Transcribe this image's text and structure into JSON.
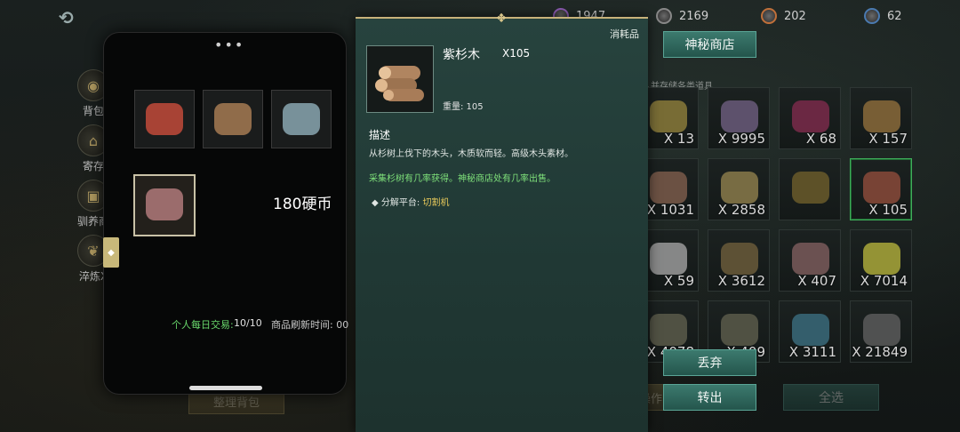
{
  "currencies": [
    {
      "icon": "purple-gem-icon",
      "value": "1947"
    },
    {
      "icon": "silver-coin-icon",
      "value": "2169"
    },
    {
      "icon": "orange-coin-icon",
      "value": "202"
    },
    {
      "icon": "blue-orb-icon",
      "value": "62"
    }
  ],
  "side_menu": [
    {
      "label": "背包",
      "icon": "bag-icon"
    },
    {
      "label": "寄存",
      "icon": "house-icon"
    },
    {
      "label": "驯养商",
      "icon": "chest-icon"
    },
    {
      "label": "淬炼X",
      "icon": "feather-icon"
    }
  ],
  "shop": {
    "mystery_shop_label": "神秘商店",
    "hint": "入并存储各类道具"
  },
  "bag_slots": [
    {
      "qty": "X 13",
      "color": "#8a7a3a"
    },
    {
      "qty": "X 9995",
      "color": "#6a5a7a"
    },
    {
      "qty": "X 68",
      "color": "#7a2a4a"
    },
    {
      "qty": "X 157",
      "color": "#8a6a3a"
    },
    {
      "qty": "X 1031",
      "color": "#7a5a4a"
    },
    {
      "qty": "X 2858",
      "color": "#8a7a4a"
    },
    {
      "qty": "",
      "color": "#6a5a2a"
    },
    {
      "qty": "X 105",
      "color": "#8a4a3a"
    },
    {
      "qty": "X 59",
      "color": "#9a9a9a"
    },
    {
      "qty": "X 3612",
      "color": "#6a5a3a"
    },
    {
      "qty": "X 407",
      "color": "#7a5a5a"
    },
    {
      "qty": "X 7014",
      "color": "#aaa83a"
    },
    {
      "qty": "X 4078",
      "color": "#5a5a4a"
    },
    {
      "qty": "X 409",
      "color": "#5a5a4a"
    },
    {
      "qty": "X 3111",
      "color": "#3a6a7a"
    },
    {
      "qty": "X 21849",
      "color": "#5a5a5a"
    }
  ],
  "buttons": {
    "discard": "丢弃",
    "transfer": "转出",
    "select_all_1": "全选",
    "select_all_2": "全选",
    "batch_op": "批量操作",
    "sort": "整理背包"
  },
  "phone": {
    "menu_dots": "•••",
    "price": "180硬币",
    "daily_trade_label": "个人每日交易:",
    "daily_trade_value": "10/10",
    "refresh_label": "商品刷新时间: 00"
  },
  "item_panel": {
    "tag": "消耗品",
    "name": "紫杉木",
    "count": "X105",
    "weight": "重量: 105",
    "section_title": "描述",
    "description": "从杉树上伐下的木头，木质软而轻。高级木头素材。",
    "source": "采集杉树有几率获得。神秘商店处有几率出售。",
    "decompose_label": "分解平台:",
    "decompose_value": "切割机"
  }
}
